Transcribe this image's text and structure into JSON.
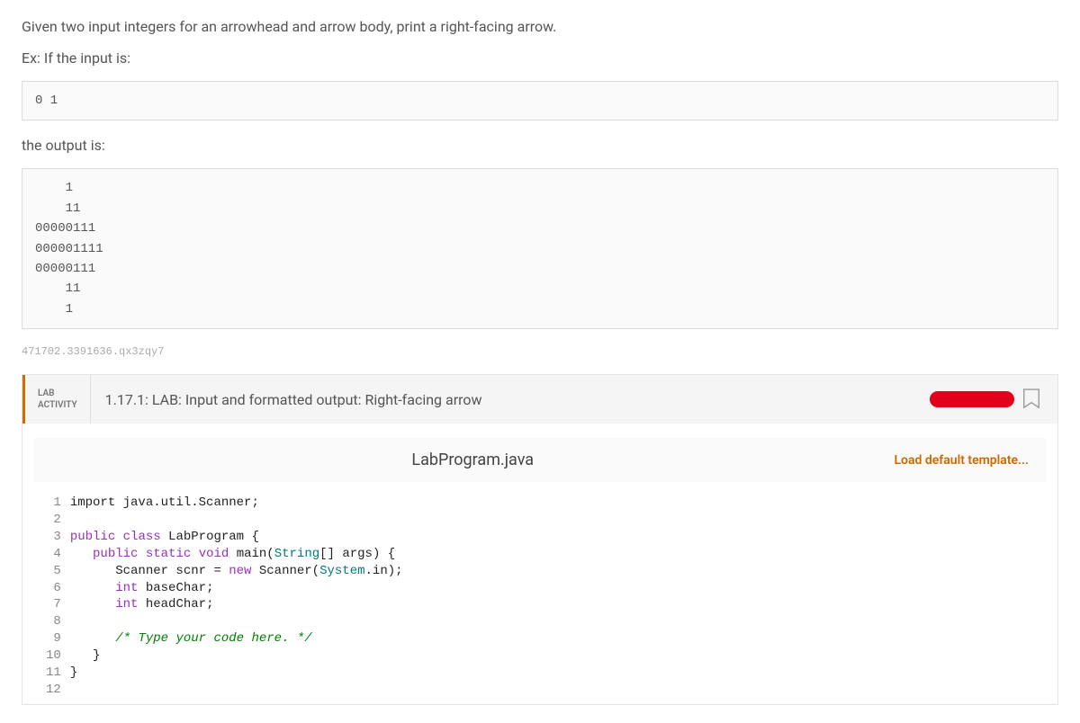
{
  "prompt": {
    "line1": "Given two input integers for an arrowhead and arrow body, print a right-facing arrow.",
    "line2": "Ex: If the input is:",
    "input_example": "0 1",
    "line3": "the output is:",
    "output_example": "    1\n    11\n00000111\n000001111\n00000111\n    11\n    1"
  },
  "footer_code": "471702.3391636.qx3zqy7",
  "lab": {
    "tag_line1": "LAB",
    "tag_line2": "ACTIVITY",
    "title": "1.17.1: LAB: Input and formatted output: Right-facing arrow"
  },
  "file": {
    "name": "LabProgram.java",
    "load_template": "Load default template..."
  },
  "editor": {
    "line_numbers": [
      "1",
      "2",
      "3",
      "4",
      "5",
      "6",
      "7",
      "8",
      "9",
      "10",
      "11",
      "12"
    ],
    "lines": [
      {
        "t": "plain",
        "text": "import java.util.Scanner;"
      },
      {
        "t": "plain",
        "text": ""
      },
      {
        "t": "raw",
        "html": "<span class='kw'>public</span> <span class='kw'>class</span> LabProgram {"
      },
      {
        "t": "raw",
        "html": "   <span class='kw'>public</span> <span class='kw'>static</span> <span class='kw'>void</span> main(<span class='type'>String</span>[] args) {"
      },
      {
        "t": "raw",
        "html": "      Scanner scnr = <span class='kw'>new</span> Scanner(<span class='type'>System</span>.in);"
      },
      {
        "t": "raw",
        "html": "      <span class='kw'>int</span> baseChar;"
      },
      {
        "t": "raw",
        "html": "      <span class='kw'>int</span> headChar;"
      },
      {
        "t": "plain",
        "text": ""
      },
      {
        "t": "raw",
        "html": "      <span class='cmt'>/* Type your code here. */</span>"
      },
      {
        "t": "plain",
        "text": "   }"
      },
      {
        "t": "plain",
        "text": "}"
      },
      {
        "t": "plain",
        "text": ""
      }
    ]
  }
}
